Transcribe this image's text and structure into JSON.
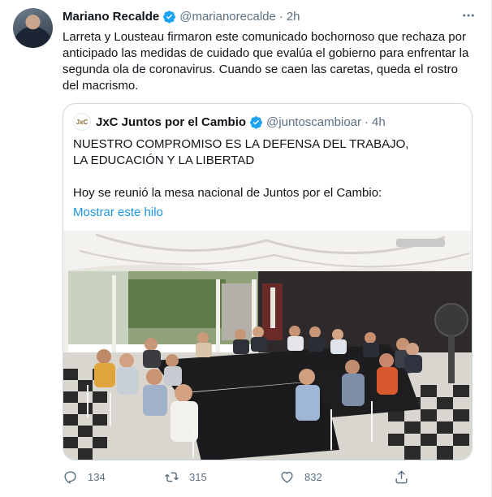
{
  "tweet": {
    "author_name": "Mariano Recalde",
    "handle": "@marianorecalde",
    "separator": "·",
    "time": "2h",
    "more_icon": "more-horizontal-icon",
    "text": "Larreta y Lousteau firmaron este comunicado bochornoso que rechaza por anticipado las medidas de cuidado que evalúa el gobierno para enfrentar la segunda ola de coronavirus. Cuando se caen las caretas, queda el rostro del macrismo."
  },
  "quoted": {
    "logo_text": "JxC",
    "author_name": "JxC Juntos por el Cambio",
    "handle": "@juntoscambioar",
    "separator": "·",
    "time": "4h",
    "headline": "NUESTRO COMPROMISO ES LA DEFENSA DEL TRABAJO,\nLA EDUCACIÓN Y LA LIBERTAD",
    "body": "Hoy se reunió la mesa nacional de Juntos por el Cambio:",
    "link": "Mostrar este hilo"
  },
  "actions": {
    "replies": "134",
    "retweets": "315",
    "likes": "832"
  },
  "colors": {
    "accent": "#1b95e0",
    "muted": "#5b7083",
    "border": "#cfd9de"
  }
}
